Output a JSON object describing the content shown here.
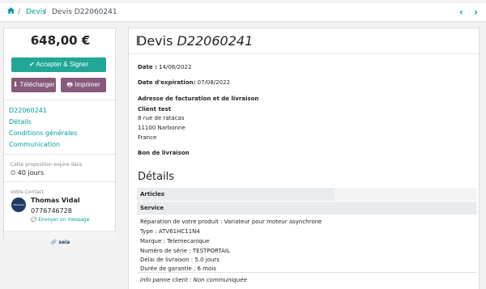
{
  "breadcrumb": {
    "home_icon": "home-icon",
    "sep1": "/",
    "devis": "Devis",
    "sep2": "/",
    "current": "Devis D22060241"
  },
  "pager": {
    "prev": "‹",
    "next": "›"
  },
  "sidebar": {
    "amount": "648,00 €",
    "accept_button": "✔ Accepter & Signer",
    "download_button": "⬇ Télécharger",
    "print_button": "🖶 Imprimer",
    "nav": [
      "D22060241",
      "Détails",
      "Conditions générales",
      "Communication"
    ],
    "expiry_label": "Cette proposition expire dans",
    "expiry_days": "⏲ 40 jours",
    "contact_label": "Votre Contact",
    "avatar_text": "TRAVAUX",
    "contact_name": "Thomas Vidal",
    "contact_phone": "0776746728",
    "contact_message": "💬 Envoyer un message",
    "footer_brand": "🔗 seia"
  },
  "main": {
    "title_prefix": "Devis ",
    "title_number": "D22060241",
    "date_label": "Date :",
    "date_value": " 14/06/2022",
    "expiration_label": "Date d'expiration:",
    "expiration_value": " 07/08/2022",
    "address_label": "Adresse de facturation et de livraison",
    "client_name": "Client test",
    "address_lines": [
      "8 rue de ratacas",
      "11100 Narbonne",
      "France"
    ],
    "delivery_label": "Bon de livraison",
    "details_heading": "Détails",
    "row_articles": "Articles",
    "row_service": "Service",
    "description_lines": [
      "Réparation de votre produit : Variateur pour moteur asynchrone",
      "Type : ATV61HC11N4",
      "Marque : Telemecanique",
      "Numéro de série : TESTPORTAIL",
      "Délai de livraison : 5.0 jours",
      "Durée de garantie : 6 mois"
    ],
    "info_line": "Info panne client : Non communiquée"
  },
  "colors": {
    "accent": "#00A09D",
    "accept": "#21a796",
    "secondary": "#875a7b"
  }
}
